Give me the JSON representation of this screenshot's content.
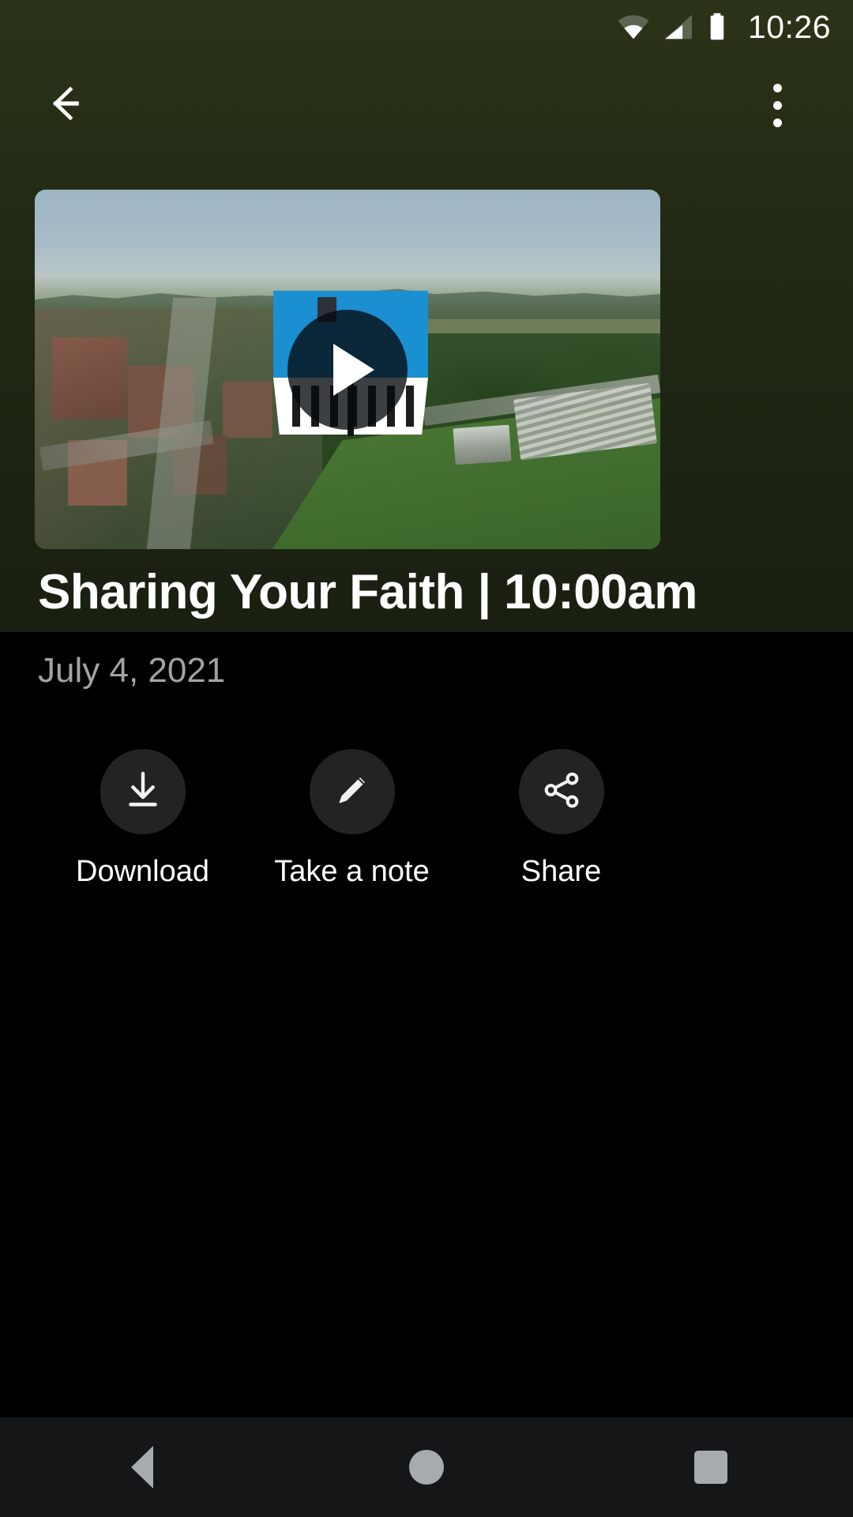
{
  "statusbar": {
    "time": "10:26",
    "wifi_icon": "wifi-icon",
    "cellular_icon": "cellular-signal-icon",
    "battery_icon": "battery-full-icon",
    "background_color": "#222a15"
  },
  "appbar": {
    "back_icon": "back-arrow-icon",
    "overflow_icon": "more-vertical-icon",
    "background_color": "#232b16"
  },
  "media": {
    "thumbnail_alt": "Aerial view of a small town with a sports field",
    "play_icon": "play-icon",
    "overlay_logo_color": "#1a8fd1"
  },
  "detail": {
    "title": "Sharing Your Faith | 10:00am",
    "date": "July 4, 2021",
    "title_color": "#ffffff",
    "date_color": "#a3a3a3"
  },
  "actions": [
    {
      "label": "Download",
      "icon": "download-icon"
    },
    {
      "label": "Take a note",
      "icon": "pencil-icon"
    },
    {
      "label": "Share",
      "icon": "share-icon"
    }
  ],
  "navbar": {
    "back_label": "Back",
    "home_label": "Home",
    "recents_label": "Recents",
    "background_color": "#141618",
    "icon_color": "#a6abae"
  }
}
